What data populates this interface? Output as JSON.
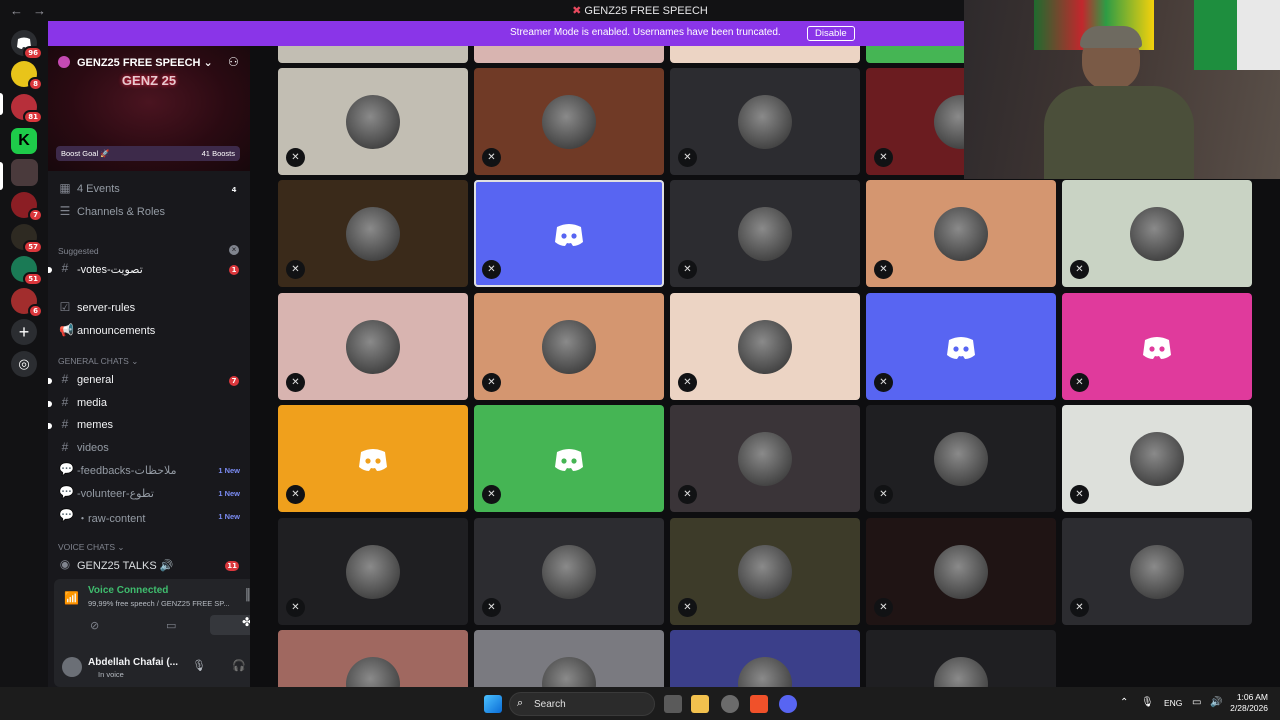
{
  "titlebar": {
    "back": "←",
    "forward": "→",
    "title": "GENZ25 FREE SPEECH"
  },
  "streamer_banner": {
    "text": "Streamer Mode is enabled. Usernames have been truncated.",
    "button": "Disable"
  },
  "server_badges": [
    "96",
    "8",
    "81",
    "7",
    "57",
    "51",
    "6"
  ],
  "guild": {
    "name": "GENZ25 FREE SPEECH",
    "logo": "GENZ 25",
    "boost_goal": "Boost Goal",
    "boost_count": "41 Boosts"
  },
  "channels": {
    "events": {
      "label": "4 Events",
      "count": "4"
    },
    "channels_roles": "Channels & Roles",
    "suggested": "Suggested",
    "votes": {
      "label": "-votes-تصويت",
      "count": "1"
    },
    "server_rules": "server-rules",
    "announcements": "announcements",
    "general_category": "GENERAL CHATS",
    "general": {
      "label": "general",
      "count": "7"
    },
    "media": "media",
    "memes": "memes",
    "videos": "videos",
    "feedbacks": {
      "label": "-feedbacks-ملاحظات",
      "new": "1 New"
    },
    "volunteer": {
      "label": "-volunteer-تطوع",
      "new": "1 New"
    },
    "raw_content": {
      "label": "・raw-content",
      "new": "1 New"
    },
    "voice_category": "VOICE CHATS",
    "talks": {
      "label": "GENZ25 TALKS 🔊",
      "count": "11"
    }
  },
  "voice": {
    "status": "Voice Connected",
    "channel": "99,99% free speech / GENZ25 FREE SP..."
  },
  "user": {
    "name": "Abdellah Chafai (...",
    "status": "In voice"
  },
  "tile_colors": [
    "#c2beb3",
    "#703a26",
    "#2c2c30",
    "#6b1c20",
    "#d2d2d0",
    "#3a2a1a",
    "#5865f2",
    "#2c2c30",
    "#d49670",
    "#c9d3c4",
    "#d8b4b0",
    "#d49670",
    "#ecd4c4",
    "#5865f2",
    "#e03a9c",
    "#f0a01c",
    "#45b554",
    "#3a3438",
    "#1f1f22",
    "#dde0db",
    "#1f1f22",
    "#2c2c30",
    "#3d3b29",
    "#1f1414",
    "#2c2c30",
    "#a06860",
    "#7a7a80",
    "#3b3f8a",
    "#1f1f22"
  ],
  "taskbar": {
    "search": "Search",
    "lang": "ENG",
    "time": "1:06 AM",
    "date": "2/28/2026"
  }
}
